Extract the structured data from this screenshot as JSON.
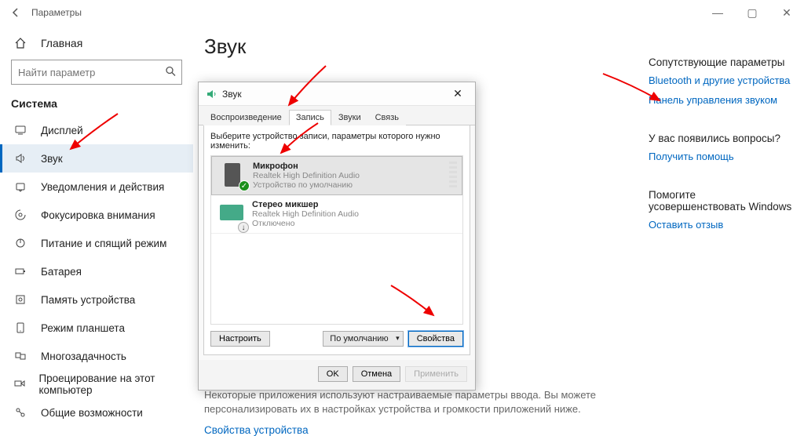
{
  "window": {
    "title": "Параметры"
  },
  "home": {
    "label": "Главная"
  },
  "search": {
    "placeholder": "Найти параметр"
  },
  "section_title": "Система",
  "nav": [
    {
      "icon": "display",
      "label": "Дисплей"
    },
    {
      "icon": "sound",
      "label": "Звук",
      "active": true
    },
    {
      "icon": "notify",
      "label": "Уведомления и действия"
    },
    {
      "icon": "focus",
      "label": "Фокусировка внимания"
    },
    {
      "icon": "power",
      "label": "Питание и спящий режим"
    },
    {
      "icon": "battery",
      "label": "Батарея"
    },
    {
      "icon": "storage",
      "label": "Память устройства"
    },
    {
      "icon": "tablet",
      "label": "Режим планшета"
    },
    {
      "icon": "multi",
      "label": "Многозадачность"
    },
    {
      "icon": "project",
      "label": "Проецирование на этот компьютер"
    },
    {
      "icon": "shared",
      "label": "Общие возможности"
    }
  ],
  "main": {
    "title": "Звук",
    "desc": "Некоторые приложения используют настраиваемые параметры ввода. Вы можете персонализировать их в настройках устройства и громкости приложений ниже.",
    "link": "Свойства устройства"
  },
  "right": {
    "s1": {
      "title": "Сопутствующие параметры",
      "links": [
        "Bluetooth и другие устройства",
        "Панель управления звуком"
      ]
    },
    "s2": {
      "title": "У вас появились вопросы?",
      "links": [
        "Получить помощь"
      ]
    },
    "s3": {
      "title": "Помогите усовершенствовать Windows",
      "links": [
        "Оставить отзыв"
      ]
    }
  },
  "dialog": {
    "title": "Звук",
    "tabs": [
      "Воспроизведение",
      "Запись",
      "Звуки",
      "Связь"
    ],
    "active_tab": 1,
    "prompt": "Выберите устройство записи, параметры которого нужно изменить:",
    "devices": [
      {
        "name": "Микрофон",
        "desc1": "Realtek High Definition Audio",
        "desc2": "Устройство по умолчанию",
        "selected": true,
        "kind": "mic"
      },
      {
        "name": "Стерео микшер",
        "desc1": "Realtek High Definition Audio",
        "desc2": "Отключено",
        "selected": false,
        "kind": "mixer"
      }
    ],
    "configure": "Настроить",
    "set_default": "По умолчанию",
    "properties": "Свойства",
    "ok": "OK",
    "cancel": "Отмена",
    "apply": "Применить"
  }
}
